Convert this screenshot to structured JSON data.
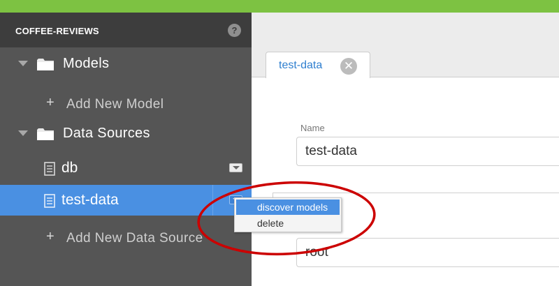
{
  "sidebar": {
    "project_name": "COFFEE-REVIEWS",
    "help_glyph": "?",
    "models": {
      "label": "Models",
      "add_plus": "+",
      "add_label": "Add New Model"
    },
    "datasources": {
      "label": "Data Sources",
      "items": [
        {
          "label": "db"
        },
        {
          "label": "test-data"
        }
      ],
      "add_plus": "+",
      "add_label": "Add New Data Source"
    }
  },
  "context_menu": {
    "items": [
      {
        "label": "discover models"
      },
      {
        "label": "delete"
      }
    ]
  },
  "main": {
    "tab": {
      "label": "test-data",
      "close_glyph": "✕"
    },
    "form": {
      "name_label": "Name",
      "name_value": "test-data",
      "username_value": "root"
    }
  },
  "colors": {
    "top_bar": "#7dc242",
    "sidebar": "#555555",
    "active_row": "#4a90e2",
    "annotation": "#cc0000"
  }
}
